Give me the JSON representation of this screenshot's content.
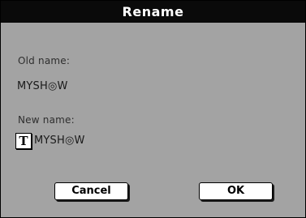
{
  "dialog": {
    "title": "Rename",
    "old_name_label": "Old name:",
    "old_name_value": "MYSH◎W",
    "new_name_label": "New name:",
    "text_edit_icon_glyph": "T",
    "new_name_value": "MYSH◎W",
    "cancel_label": "Cancel",
    "ok_label": "OK"
  },
  "colors": {
    "titlebar": "#0a0a0a",
    "body": "#a3a3a3",
    "button": "#ffffff"
  }
}
